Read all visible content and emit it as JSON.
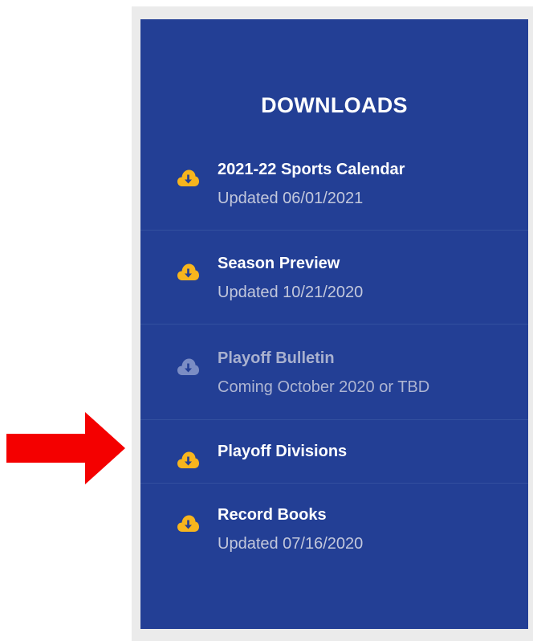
{
  "downloads": {
    "title": "DOWNLOADS",
    "items": [
      {
        "label": "2021-22 Sports Calendar",
        "status": "Updated 06/01/2021",
        "icon": "cloud-download-icon",
        "enabled": true
      },
      {
        "label": "Season Preview",
        "status": "Updated 10/21/2020",
        "icon": "cloud-download-icon",
        "enabled": true
      },
      {
        "label": "Playoff Bulletin",
        "status": "Coming October 2020 or TBD",
        "icon": "cloud-download-icon",
        "enabled": false
      },
      {
        "label": "Playoff Divisions",
        "status": "",
        "icon": "cloud-download-icon",
        "enabled": true
      },
      {
        "label": "Record Books",
        "status": "Updated 07/16/2020",
        "icon": "cloud-download-icon",
        "enabled": true
      }
    ]
  },
  "annotation": {
    "icon": "red-arrow-icon",
    "color": "#f40000"
  },
  "colors": {
    "panel": "#233f95",
    "icon_active": "#f7b51d",
    "icon_disabled": "#7b8dc4",
    "divider": "#33509f"
  }
}
